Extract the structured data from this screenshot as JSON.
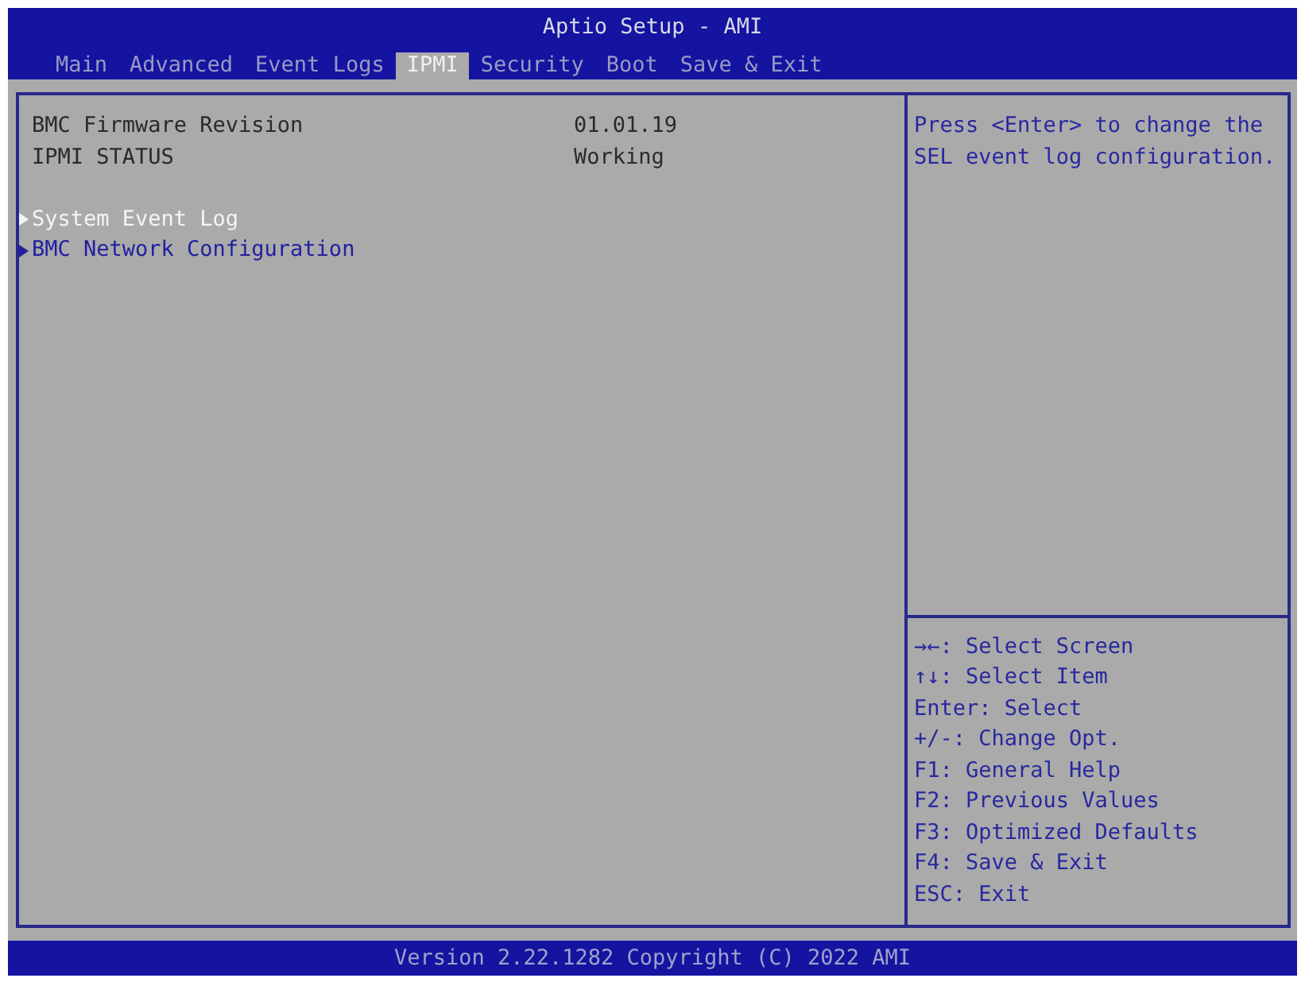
{
  "window": {
    "title": "Aptio Setup - AMI"
  },
  "tabs": [
    {
      "label": "Main",
      "selected": false
    },
    {
      "label": "Advanced",
      "selected": false
    },
    {
      "label": "Event Logs",
      "selected": false
    },
    {
      "label": "IPMI",
      "selected": true
    },
    {
      "label": "Security",
      "selected": false
    },
    {
      "label": "Boot",
      "selected": false
    },
    {
      "label": "Save & Exit",
      "selected": false
    }
  ],
  "info_rows": [
    {
      "label": "BMC Firmware Revision",
      "value": "01.01.19"
    },
    {
      "label": "IPMI STATUS",
      "value": "Working"
    }
  ],
  "submenus": [
    {
      "label": "System Event Log",
      "selected": true
    },
    {
      "label": "BMC Network Configuration",
      "selected": false
    }
  ],
  "help_text": "Press <Enter> to change the SEL event log configuration.",
  "key_legend": [
    "→←: Select Screen",
    "↑↓: Select Item",
    "Enter: Select",
    "+/-: Change Opt.",
    "F1: General Help",
    "F2: Previous Values",
    "F3: Optimized Defaults",
    "F4: Save & Exit",
    "ESC: Exit"
  ],
  "status_bar": "Version 2.22.1282 Copyright (C) 2022 AMI"
}
